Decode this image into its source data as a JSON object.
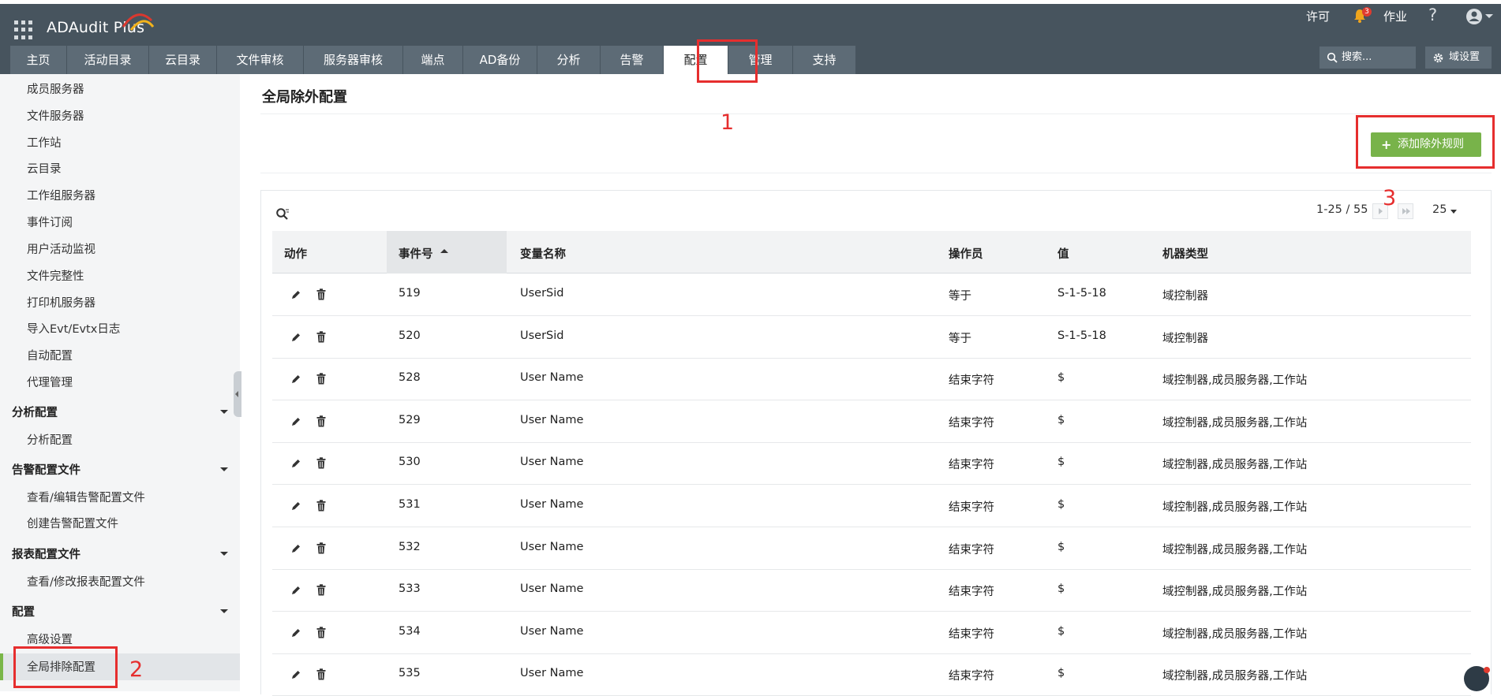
{
  "app": {
    "name": "ADAudit Plus"
  },
  "top_bar": {
    "license": "许可",
    "notification_count": "3",
    "jobs": "作业",
    "help": "?"
  },
  "nav": {
    "tabs": [
      "主页",
      "活动目录",
      "云目录",
      "文件审核",
      "服务器审核",
      "端点",
      "AD备份",
      "分析",
      "告警",
      "配置",
      "管理",
      "支持"
    ],
    "active": "配置",
    "search_placeholder": "搜索...",
    "domain_settings": "域设置"
  },
  "sidebar": {
    "items_top": [
      "成员服务器",
      "文件服务器",
      "工作站",
      "云目录",
      "工作组服务器",
      "事件订阅",
      "用户活动监视",
      "文件完整性",
      "打印机服务器",
      "导入Evt/Evtx日志",
      "自动配置",
      "代理管理"
    ],
    "groups": [
      {
        "title": "分析配置",
        "items": [
          "分析配置"
        ]
      },
      {
        "title": "告警配置文件",
        "items": [
          "查看/编辑告警配置文件",
          "创建告警配置文件"
        ]
      },
      {
        "title": "报表配置文件",
        "items": [
          "查看/修改报表配置文件"
        ]
      },
      {
        "title": "配置",
        "items": [
          "高级设置",
          "全局排除配置"
        ]
      }
    ],
    "active_item": "全局排除配置"
  },
  "main": {
    "title": "全局除外配置",
    "add_button": "添加除外规则",
    "pagination": "1-25 / 55",
    "per_page": "25",
    "columns": [
      "动作",
      "事件号",
      "变量名称",
      "操作员",
      "值",
      "机器类型"
    ],
    "sorted_column": "事件号",
    "rows": [
      {
        "event": "519",
        "variable": "UserSid",
        "operator": "等于",
        "value": "S-1-5-18",
        "machine": "域控制器"
      },
      {
        "event": "520",
        "variable": "UserSid",
        "operator": "等于",
        "value": "S-1-5-18",
        "machine": "域控制器"
      },
      {
        "event": "528",
        "variable": "User Name",
        "operator": "结束字符",
        "value": "$",
        "machine": "域控制器,成员服务器,工作站"
      },
      {
        "event": "529",
        "variable": "User Name",
        "operator": "结束字符",
        "value": "$",
        "machine": "域控制器,成员服务器,工作站"
      },
      {
        "event": "530",
        "variable": "User Name",
        "operator": "结束字符",
        "value": "$",
        "machine": "域控制器,成员服务器,工作站"
      },
      {
        "event": "531",
        "variable": "User Name",
        "operator": "结束字符",
        "value": "$",
        "machine": "域控制器,成员服务器,工作站"
      },
      {
        "event": "532",
        "variable": "User Name",
        "operator": "结束字符",
        "value": "$",
        "machine": "域控制器,成员服务器,工作站"
      },
      {
        "event": "533",
        "variable": "User Name",
        "operator": "结束字符",
        "value": "$",
        "machine": "域控制器,成员服务器,工作站"
      },
      {
        "event": "534",
        "variable": "User Name",
        "operator": "结束字符",
        "value": "$",
        "machine": "域控制器,成员服务器,工作站"
      },
      {
        "event": "535",
        "variable": "User Name",
        "operator": "结束字符",
        "value": "$",
        "machine": "域控制器,成员服务器,工作站"
      }
    ]
  },
  "annotations": [
    "1",
    "2",
    "3"
  ],
  "colors": {
    "header": "#47545e",
    "tab": "#5d6b76",
    "accent_green": "#78b34a",
    "annotation_red": "#e62e2e"
  },
  "icons": [
    "apps-grid-icon",
    "bell-icon",
    "user-icon",
    "search-icon",
    "gear-icon",
    "plus-icon",
    "edit-pencil-icon",
    "delete-trash-icon",
    "sort-asc-icon",
    "chat-icon"
  ]
}
